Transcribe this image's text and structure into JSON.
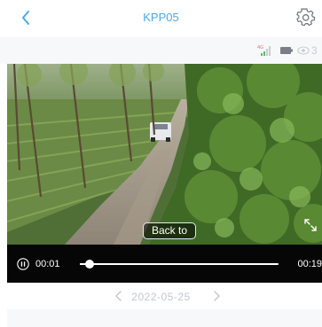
{
  "header": {
    "title": "KPP05",
    "back_icon": "chevron-left-icon",
    "settings_icon": "gear-icon"
  },
  "status": {
    "signal_icon": "cellular-signal-icon",
    "battery_icon": "battery-icon",
    "view_icon": "eye-icon",
    "view_count": "3"
  },
  "video": {
    "back_to_label": "Back to",
    "fullscreen_icon": "fullscreen-icon"
  },
  "playback": {
    "pause_icon": "pause-icon",
    "current_time": "00:01",
    "total_time": "00:19",
    "progress_fraction": 0.05
  },
  "date_nav": {
    "date": "2022-05-25",
    "prev_icon": "chevron-left-icon",
    "next_icon": "chevron-right-icon"
  },
  "colors": {
    "accent": "#4aa8f0",
    "muted": "#c3c7cd",
    "player_bg": "#060606"
  }
}
